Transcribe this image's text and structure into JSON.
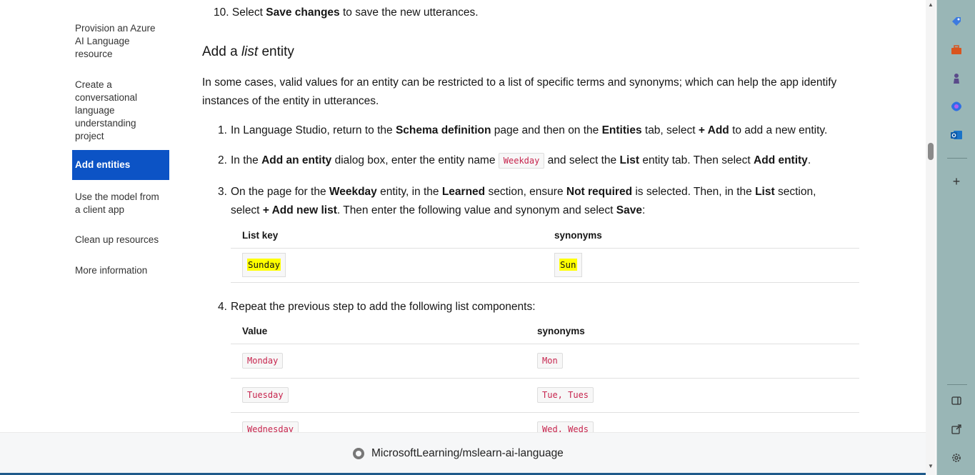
{
  "toc": {
    "items": [
      {
        "label": "Provision an Azure AI Language resource",
        "active": false
      },
      {
        "label": "Create a conversational language understanding project",
        "active": false
      },
      {
        "label": "Add entities",
        "active": true
      },
      {
        "label": "Use the model from a client app",
        "active": false
      },
      {
        "label": "Clean up resources",
        "active": false
      },
      {
        "label": "More information",
        "active": false
      }
    ]
  },
  "content": {
    "step10": {
      "num": "10.",
      "pre": "Select ",
      "bold": "Save changes",
      "post": " to save the new utterances."
    },
    "heading": {
      "pre": "Add a ",
      "italic": "list",
      "post": " entity"
    },
    "intro": "In some cases, valid values for an entity can be restricted to a list of specific terms and synonyms; which can help the app identify instances of the entity in utterances.",
    "step1": {
      "num": "1.",
      "t1": "In Language Studio, return to the ",
      "b1": "Schema definition",
      "t2": " page and then on the ",
      "b2": "Entities",
      "t3": " tab, select ",
      "b3": "+ Add",
      "t4": " to add a new entity."
    },
    "step2": {
      "num": "2.",
      "t1": "In the ",
      "b1": "Add an entity",
      "t2": " dialog box, enter the entity name ",
      "code": "Weekday",
      "t3": " and select the ",
      "b2": "List",
      "t4": " entity tab. Then select ",
      "b3": "Add entity",
      "t5": "."
    },
    "step3": {
      "num": "3.",
      "t1": "On the page for the ",
      "b1": "Weekday",
      "t2": " entity, in the ",
      "b2": "Learned",
      "t3": " section, ensure ",
      "b3": "Not required",
      "t4": " is selected. Then, in the ",
      "b4": "List",
      "t5": " section,",
      "t6": "select ",
      "b5": "+ Add new list",
      "t7": ". Then enter the following value and synonym and select ",
      "b6": "Save",
      "t8": ":"
    },
    "table1": {
      "headers": [
        "List key",
        "synonyms"
      ],
      "rows": [
        [
          "Sunday",
          "Sun"
        ]
      ]
    },
    "step4": {
      "num": "4.",
      "text": "Repeat the previous step to add the following list components:"
    },
    "table2": {
      "headers": [
        "Value",
        "synonyms"
      ],
      "rows": [
        [
          "Monday",
          "Mon"
        ],
        [
          "Tuesday",
          "Tue, Tues"
        ],
        [
          "Wednesday",
          "Wed, Weds"
        ]
      ]
    }
  },
  "footer": {
    "repo_link": "MicrosoftLearning/mslearn-ai-language",
    "icon": "github-icon"
  },
  "edge_sidebar": {
    "icons": [
      "tag-icon",
      "briefcase-icon",
      "chess-icon",
      "copilot-icon",
      "outlook-icon",
      "add-icon",
      "split-screen-icon",
      "external-link-icon",
      "settings-icon"
    ]
  },
  "colors": {
    "accent": "#0c53c5",
    "code": "#c7254e",
    "highlight": "#ffff00",
    "edge": "#99b6b6"
  }
}
